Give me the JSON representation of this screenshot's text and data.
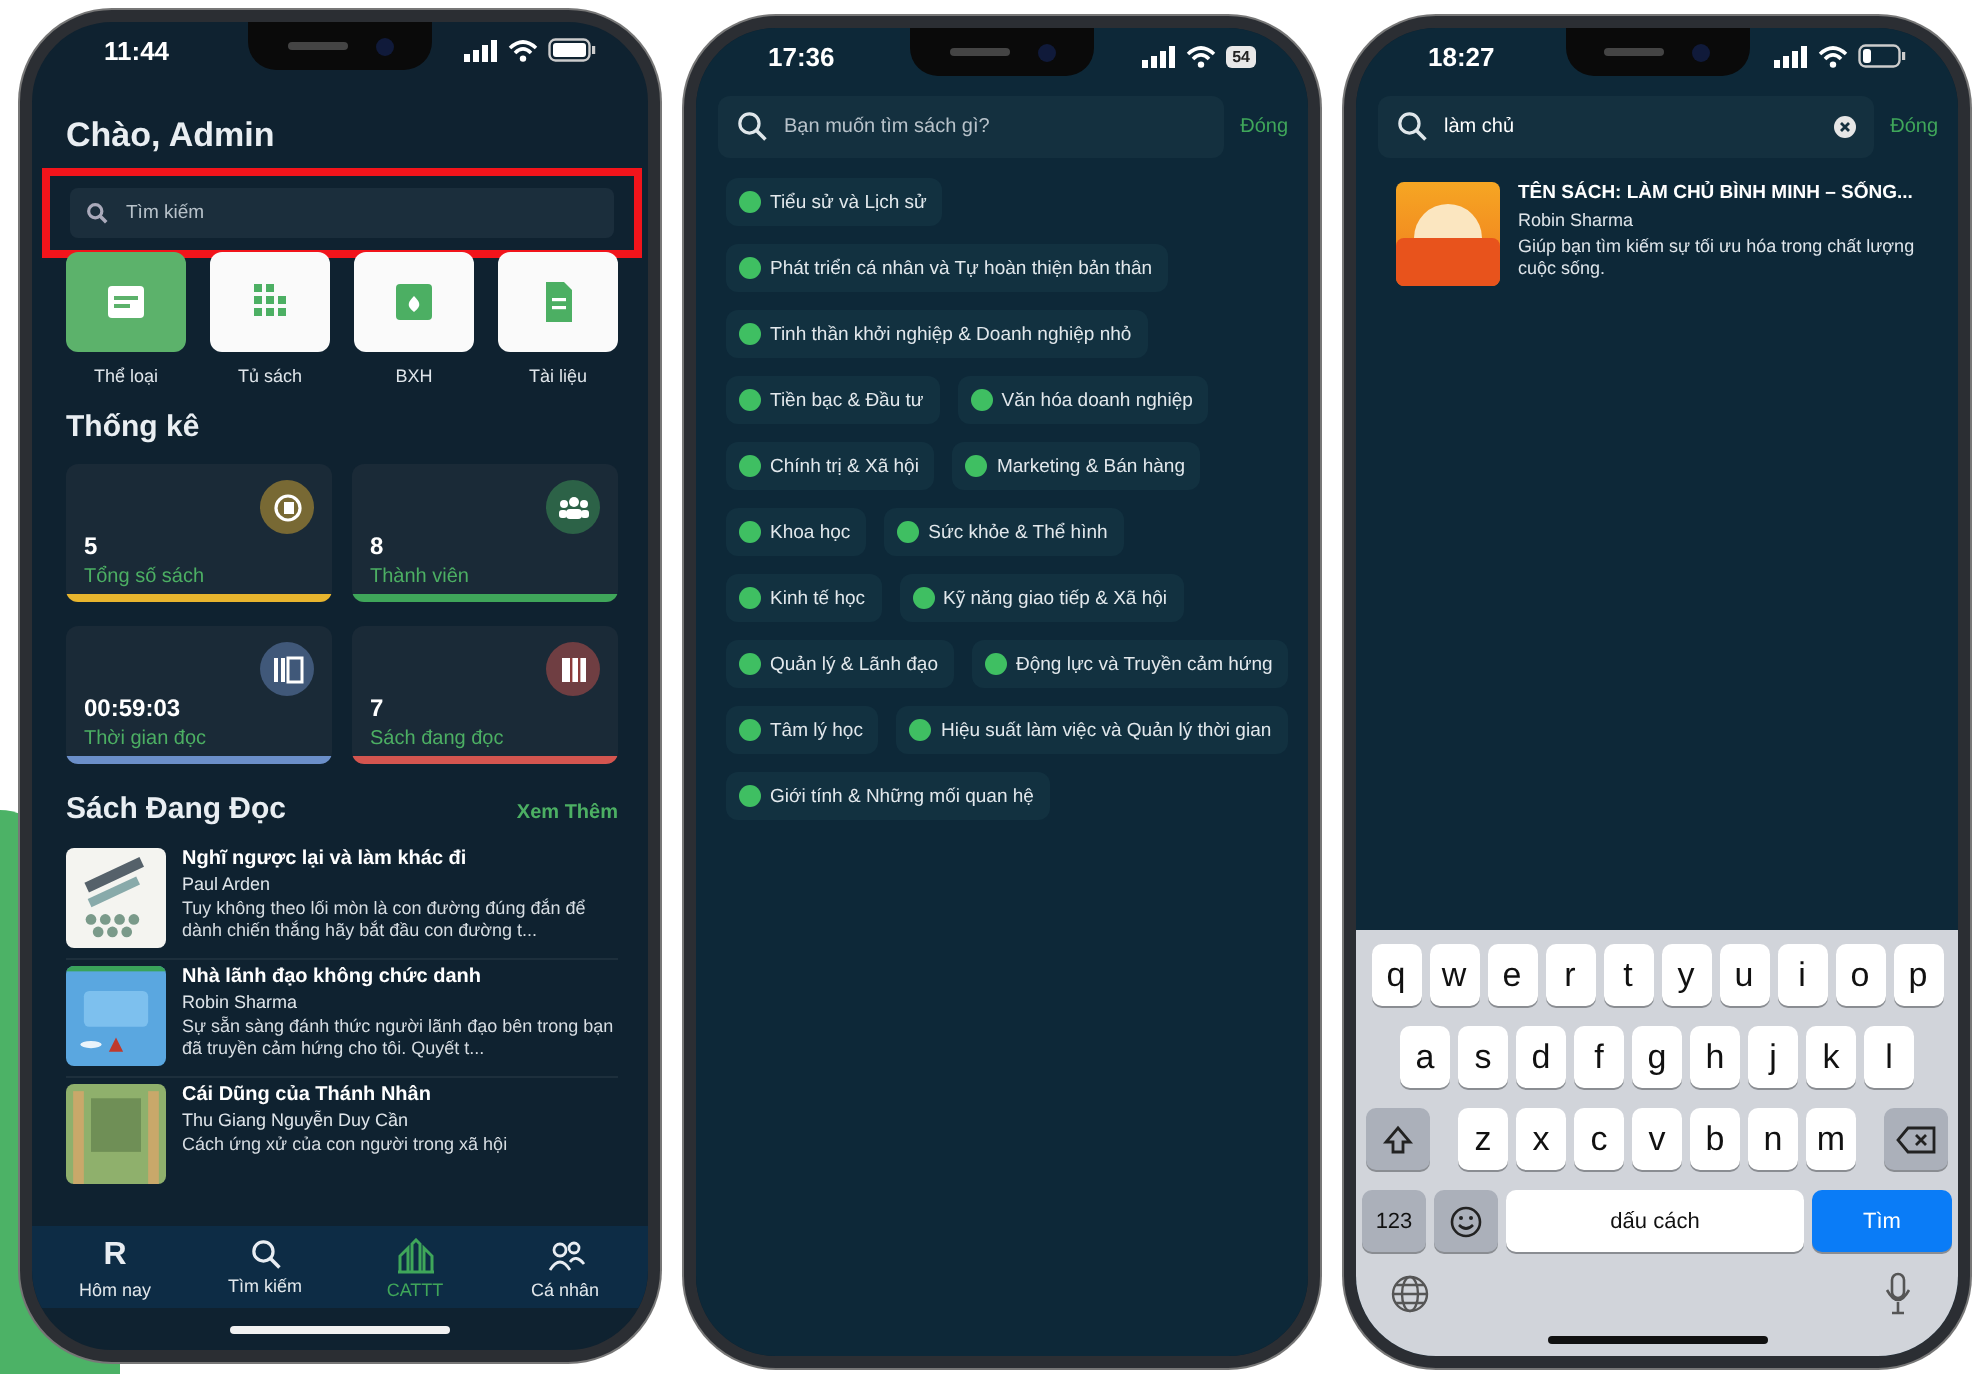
{
  "phones": [
    {
      "kind": "home",
      "status": {
        "time": "11:44"
      },
      "greeting": "Chào, Admin",
      "search": {
        "placeholder": "Tìm kiếm",
        "highlighted": true
      },
      "shortcuts": [
        {
          "label": "Thể loại",
          "selected": true
        },
        {
          "label": "Tủ sách",
          "selected": false
        },
        {
          "label": "BXH",
          "selected": false
        },
        {
          "label": "Tài liệu",
          "selected": false
        }
      ],
      "stats_title": "Thống kê",
      "stats": [
        {
          "value": "5",
          "label": "Tổng số sách",
          "color": "#e8b52e"
        },
        {
          "value": "8",
          "label": "Thành viên",
          "color": "#3fa65a"
        },
        {
          "value": "00:59:03",
          "label": "Thời gian đọc",
          "color": "#6b8fc9"
        },
        {
          "value": "7",
          "label": "Sách đang đọc",
          "color": "#d4554f"
        }
      ],
      "reading": {
        "title": "Sách Đang Đọc",
        "more": "Xem Thêm",
        "books": [
          {
            "title": "Nghĩ ngược lại và làm khác đi",
            "author": "Paul Arden",
            "description": "Tuy không theo lối mòn là con đường đúng đắn để dành chiến thắng hãy bắt đầu con đường t..."
          },
          {
            "title": "Nhà lãnh đạo không chức danh",
            "author": "Robin Sharma",
            "description": "Sự sẵn sàng đánh thức người lãnh đạo bên trong bạn đã truyền cảm hứng cho tôi. Quyết t..."
          },
          {
            "title": "Cái Dũng của Thánh Nhân",
            "author": "Thu Giang Nguyễn Duy Cần",
            "description": "Cách ứng xử của con người trong xã hội"
          }
        ]
      },
      "tabs": [
        {
          "kind": "letter",
          "glyph": "R",
          "label": "Hôm nay",
          "selected": false
        },
        {
          "kind": "search",
          "label": "Tìm kiếm",
          "selected": false
        },
        {
          "kind": "chart",
          "label": "CATTT",
          "selected": true
        },
        {
          "kind": "people",
          "label": "Cá nhân",
          "selected": false
        }
      ]
    },
    {
      "kind": "categories",
      "status": {
        "time": "17:36",
        "battery": "54"
      },
      "search": {
        "placeholder": "Bạn muốn tìm sách gì?"
      },
      "close": "Đóng",
      "category_rows": [
        [
          "Tiểu sử và Lịch sử"
        ],
        [
          "Phát triển cá nhân và Tự hoàn thiện bản thân"
        ],
        [
          "Tinh thần khởi nghiệp & Doanh nghiệp nhỏ"
        ],
        [
          "Tiền bạc & Đầu tư",
          "Văn hóa doanh nghiệp"
        ],
        [
          "Chính trị & Xã hội",
          "Marketing & Bán hàng"
        ],
        [
          "Khoa học",
          "Sức khỏe & Thể hình"
        ],
        [
          "Kinh tế học",
          "Kỹ năng giao tiếp & Xã hội"
        ],
        [
          "Quản lý & Lãnh đạo",
          "Động lực và Truyền cảm hứng"
        ],
        [
          "Tâm lý học",
          "Hiệu suất làm việc và Quản lý thời gian"
        ],
        [
          "Giới tính & Những mối quan hệ"
        ]
      ]
    },
    {
      "kind": "results",
      "status": {
        "time": "18:27"
      },
      "search": {
        "value": "làm chủ"
      },
      "close": "Đóng",
      "results": [
        {
          "title": "TÊN SÁCH: LÀM CHỦ BÌNH MINH – SỐNG...",
          "author": "Robin Sharma",
          "description": "Giúp bạn tìm kiếm sự tối ưu hóa trong chất lượng cuộc sống."
        }
      ],
      "keyboard": {
        "rows": [
          [
            "q",
            "w",
            "e",
            "r",
            "t",
            "y",
            "u",
            "i",
            "o",
            "p"
          ],
          [
            "a",
            "s",
            "d",
            "f",
            "g",
            "h",
            "j",
            "k",
            "l"
          ],
          [
            "z",
            "x",
            "c",
            "v",
            "b",
            "n",
            "m"
          ]
        ],
        "numbers": "123",
        "space": "dấu cách",
        "go": "Tìm"
      }
    }
  ]
}
